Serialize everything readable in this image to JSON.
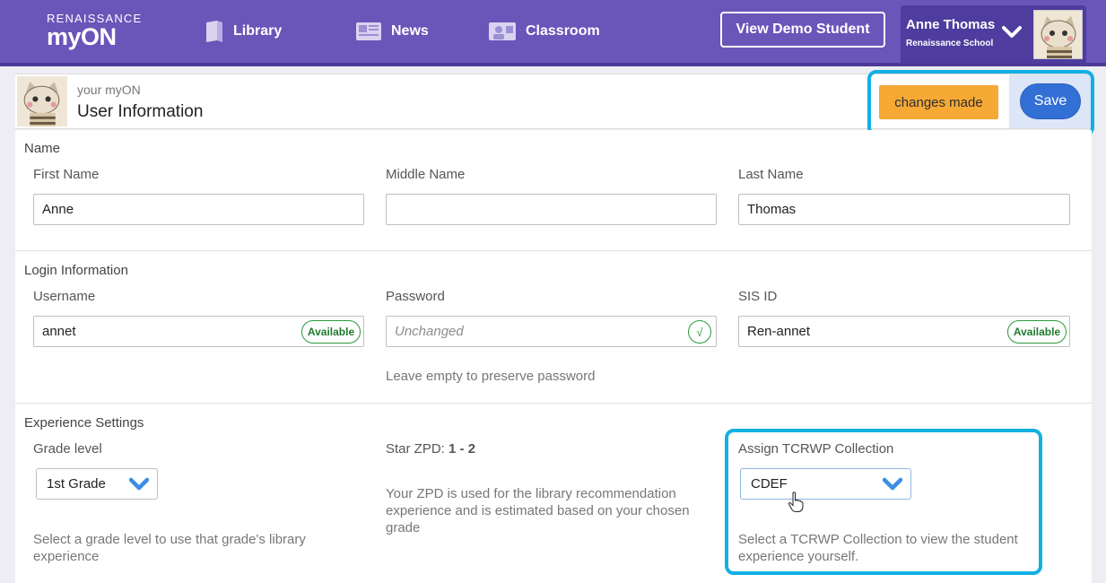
{
  "nav": {
    "logo_top": "RENAISSANCE",
    "logo_main": "myON",
    "items": [
      {
        "label": "Library",
        "icon": "book-icon"
      },
      {
        "label": "News",
        "icon": "newspaper-icon"
      },
      {
        "label": "Classroom",
        "icon": "classroom-icon"
      }
    ],
    "demo_button": "View Demo Student",
    "user_name": "Anne Thomas",
    "user_school": "Renaissance School"
  },
  "header": {
    "subtitle": "your myON",
    "title": "User Information",
    "changes_badge": "changes made",
    "save_button": "Save"
  },
  "name_section": {
    "title": "Name",
    "first_label": "First Name",
    "first_value": "Anne",
    "middle_label": "Middle Name",
    "middle_value": "",
    "last_label": "Last Name",
    "last_value": "Thomas"
  },
  "login_section": {
    "title": "Login Information",
    "username_label": "Username",
    "username_value": "annet",
    "username_status": "Available",
    "password_label": "Password",
    "password_placeholder": "Unchanged",
    "password_check": "√",
    "password_helper": "Leave empty to preserve password",
    "sis_label": "SIS ID",
    "sis_value": "Ren-annet",
    "sis_status": "Available"
  },
  "experience_section": {
    "title": "Experience Settings",
    "grade_label": "Grade level",
    "grade_value": "1st Grade",
    "grade_helper": "Select a grade level to use that grade's library experience",
    "zpd_label": "Star ZPD: ",
    "zpd_value": "1 - 2",
    "zpd_helper": "Your ZPD is used for the library recommendation experience and is estimated based on your chosen grade",
    "tcrwp_label": "Assign TCRWP Collection",
    "tcrwp_value": "CDEF",
    "tcrwp_helper": "Select a TCRWP Collection to view the student experience yourself."
  },
  "colors": {
    "nav_bg": "#6a55b9",
    "nav_dark": "#4e3d9e",
    "changes_badge": "#f7a935",
    "save_button": "#3370d6",
    "highlight_frame": "#12b0e3",
    "available_green": "#2b9a3b",
    "chevron_blue": "#3a8ee6"
  }
}
